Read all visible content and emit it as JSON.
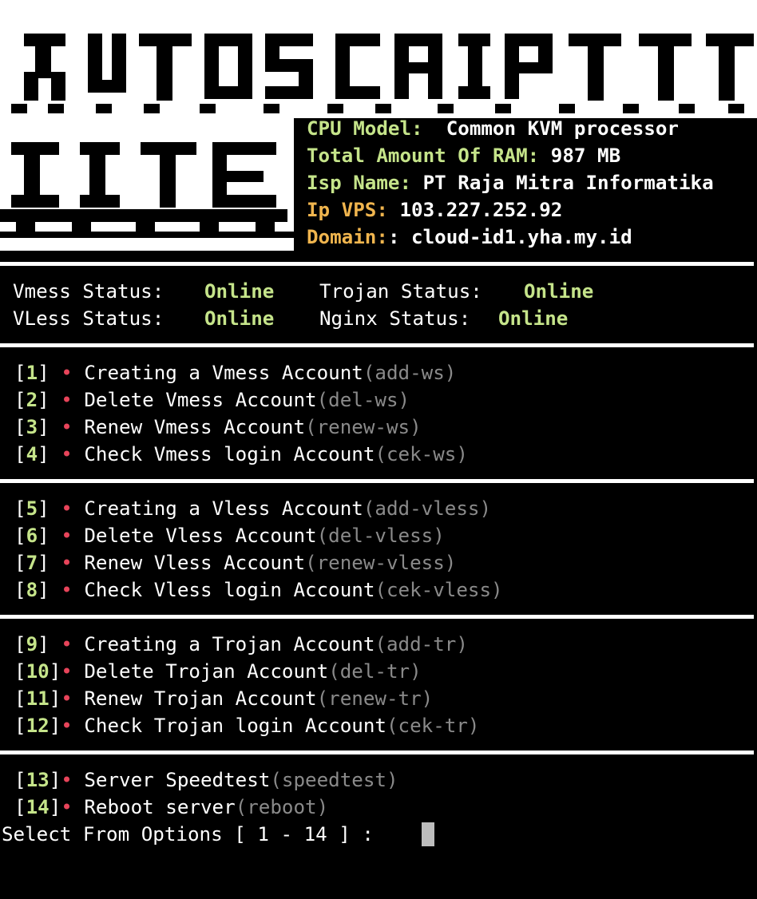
{
  "banner": {
    "line1": "AUTOSCRIPT",
    "line2": "LITE"
  },
  "sysinfo": [
    {
      "label": "CPU Model: ",
      "value": " Common KVM processor",
      "color": "green"
    },
    {
      "label": "Total Amount Of RAM:",
      "value": " 987 MB",
      "color": "green"
    },
    {
      "label": "Isp Name:",
      "value": " PT Raja Mitra Informatika",
      "color": "green"
    },
    {
      "label": "Ip VPS:",
      "value": " 103.227.252.92",
      "color": "orange"
    },
    {
      "label": "Domain:",
      "value": ": cloud-id1.yha.my.id",
      "color": "orange"
    }
  ],
  "status": {
    "vmess_label": "Vmess Status:",
    "vmess_value": "Online",
    "trojan_label": "Trojan Status:",
    "trojan_value": "Online",
    "vless_label": "VLess Status:",
    "vless_value": "Online",
    "nginx_label": "Nginx Status:",
    "nginx_value": "Online"
  },
  "menu_groups": [
    [
      {
        "num": "1",
        "label": "Creating a Vmess Account",
        "cmd": "(add-ws)"
      },
      {
        "num": "2",
        "label": "Delete Vmess Account",
        "cmd": "(del-ws)"
      },
      {
        "num": "3",
        "label": "Renew Vmess Account",
        "cmd": "(renew-ws)"
      },
      {
        "num": "4",
        "label": "Check Vmess login Account",
        "cmd": "(cek-ws)"
      }
    ],
    [
      {
        "num": "5",
        "label": "Creating a Vless Account",
        "cmd": "(add-vless)"
      },
      {
        "num": "6",
        "label": "Delete Vless Account",
        "cmd": "(del-vless)"
      },
      {
        "num": "7",
        "label": "Renew Vless Account",
        "cmd": "(renew-vless)"
      },
      {
        "num": "8",
        "label": "Check Vless login Account",
        "cmd": "(cek-vless)"
      }
    ],
    [
      {
        "num": "9",
        "label": "Creating a Trojan Account",
        "cmd": "(add-tr)"
      },
      {
        "num": "10",
        "label": "Delete Trojan Account",
        "cmd": "(del-tr)"
      },
      {
        "num": "11",
        "label": "Renew Trojan Account",
        "cmd": "(renew-tr)"
      },
      {
        "num": "12",
        "label": "Check Trojan login Account",
        "cmd": "(cek-tr)"
      }
    ],
    [
      {
        "num": "13",
        "label": "Server Speedtest",
        "cmd": "(speedtest)"
      },
      {
        "num": "14",
        "label": "Reboot server",
        "cmd": "(reboot)"
      }
    ]
  ],
  "prompt": "Select From Options [ 1 - 14 ] : ",
  "colors": {
    "green": "#c5e48a",
    "orange": "#f0b54e",
    "bullet": "#e8445a",
    "cmd": "#8a8a8a"
  }
}
